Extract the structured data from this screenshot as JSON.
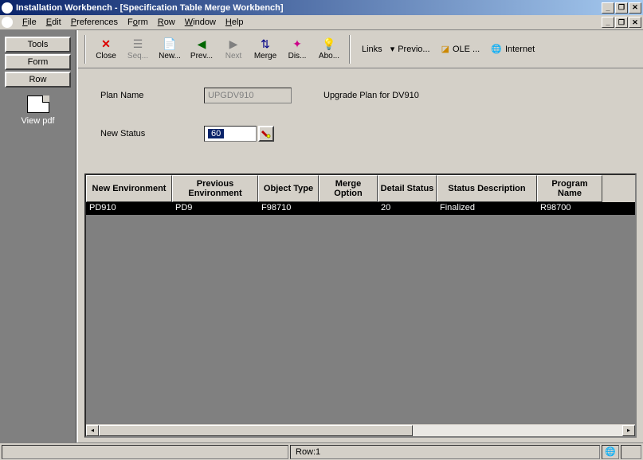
{
  "title": "Installation Workbench - [Specification Table Merge Workbench]",
  "menu": {
    "file": "File",
    "edit": "Edit",
    "preferences": "Preferences",
    "form": "Form",
    "row": "Row",
    "window": "Window",
    "help": "Help"
  },
  "sidebar": {
    "tools": "Tools",
    "form": "Form",
    "row": "Row",
    "viewpdf": "View pdf"
  },
  "toolbar": {
    "close": "Close",
    "seq": "Seq...",
    "new": "New...",
    "prev": "Prev...",
    "next": "Next",
    "merge": "Merge",
    "dis": "Dis...",
    "abo": "Abo...",
    "links": "Links",
    "previo": "Previo...",
    "ole": "OLE ...",
    "internet": "Internet"
  },
  "form": {
    "plan_name_label": "Plan Name",
    "plan_name_value": "UPGDV910",
    "plan_desc": "Upgrade Plan for DV910",
    "new_status_label": "New Status",
    "new_status_value": "60"
  },
  "grid": {
    "headers": [
      "New Environment",
      "Previous Environment",
      "Object Type",
      "Merge Option",
      "Detail Status",
      "Status Description",
      "Program Name"
    ],
    "row": [
      "PD910",
      "PD9",
      "F98710",
      "",
      "20",
      "Finalized",
      "R98700"
    ]
  },
  "status": {
    "row": "Row:1"
  }
}
